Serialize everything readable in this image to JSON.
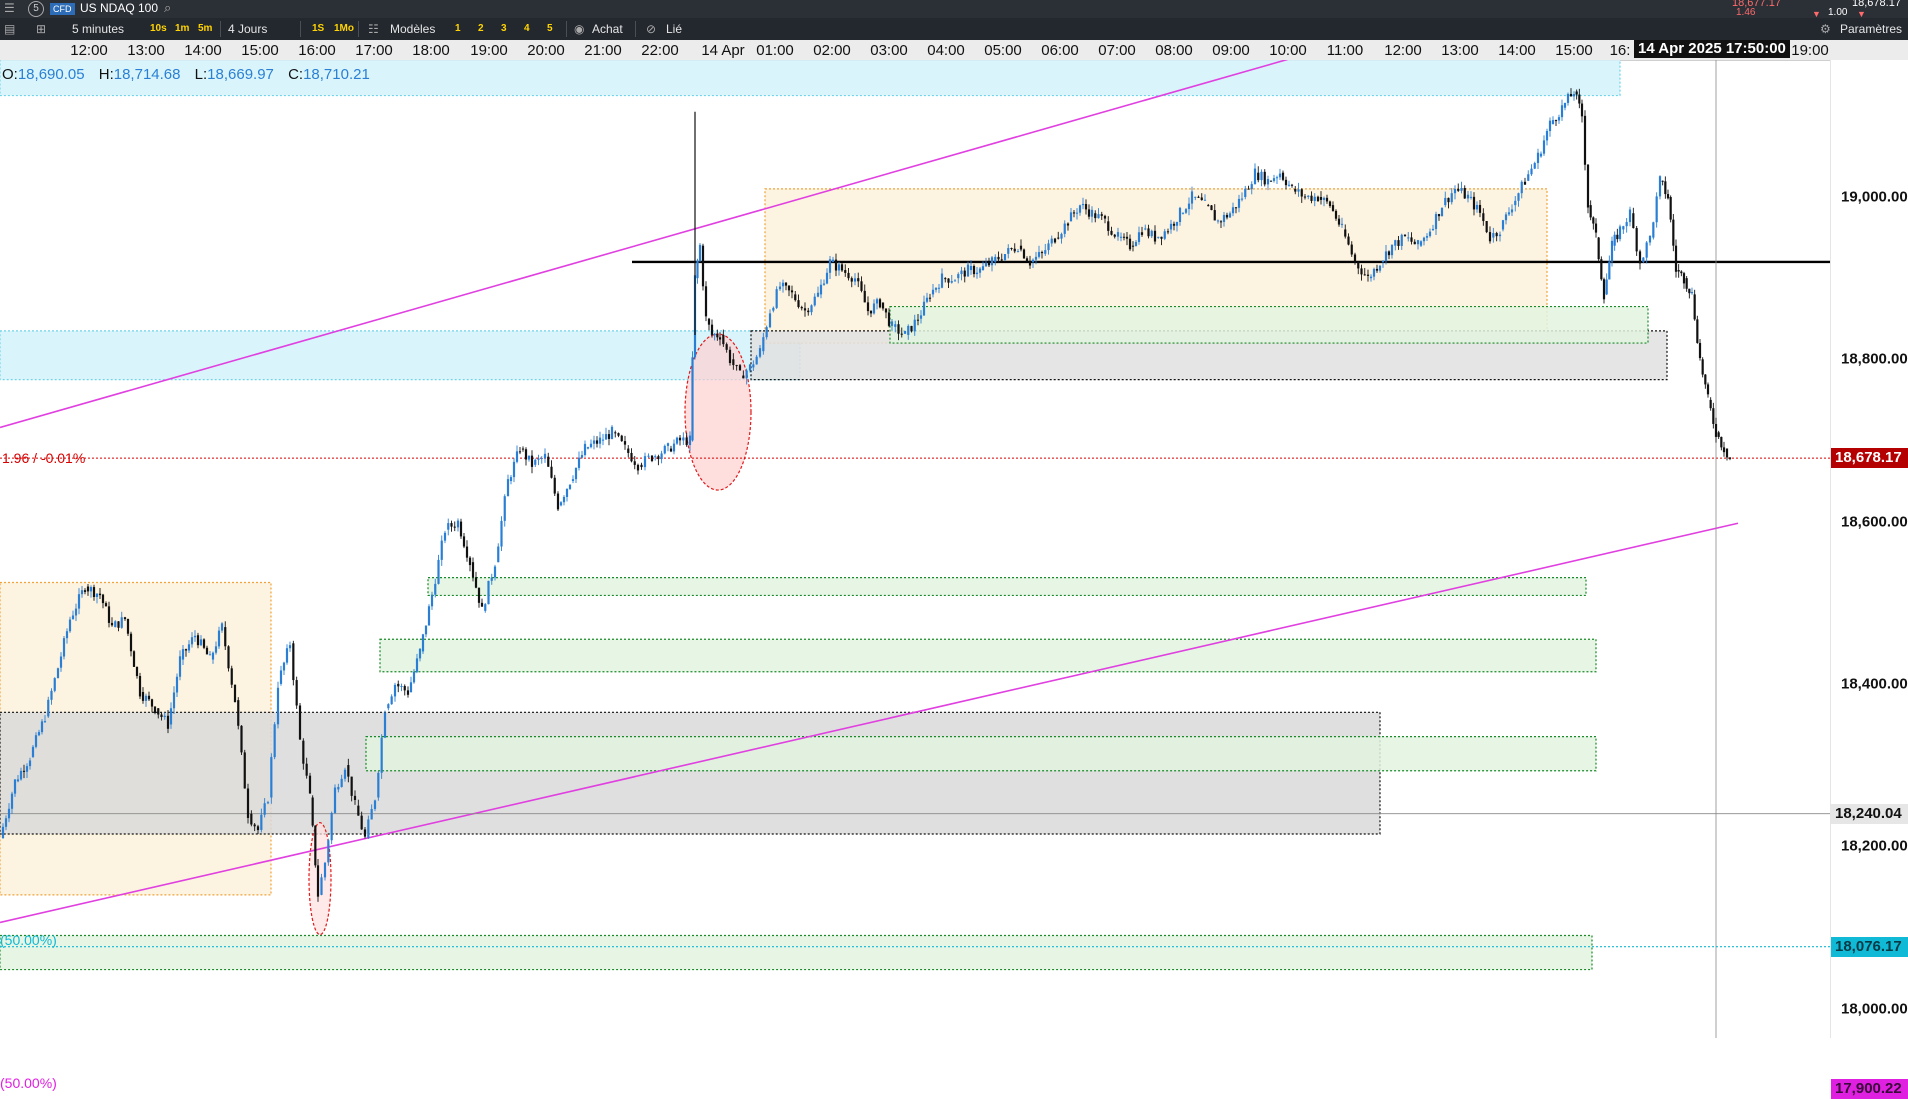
{
  "topbar": {
    "product_type": "CFD",
    "symbol": "US NDAQ 100",
    "price_left": "18,677.17",
    "price_right": "18,678.17",
    "change": "1.46",
    "qty": "1.00"
  },
  "toolbar": {
    "interval": "5 minutes",
    "btn_10s": "10s",
    "btn_1m": "1m",
    "btn_5m": "5m",
    "range": "4 Jours",
    "btn_1s": "1S",
    "btn_1mo": "1Mo",
    "templates": "Modèles",
    "n1": "1",
    "n2": "2",
    "n3": "3",
    "n4": "4",
    "n5": "5",
    "buy": "Achat",
    "linked": "Lié",
    "settings": "Paramètres"
  },
  "ohlc": {
    "o_label": "O:",
    "o": "18,690.05",
    "h_label": "H:",
    "h": "18,714.68",
    "l_label": "L:",
    "l": "18,669.97",
    "c_label": "C:",
    "c": "18,710.21"
  },
  "cursor_time": "14 Apr 2025 17:50:00",
  "chart_data": {
    "type": "candlestick",
    "interval": "5 minutes",
    "x_ticks": [
      "12:00",
      "13:00",
      "14:00",
      "15:00",
      "16:00",
      "17:00",
      "18:00",
      "19:00",
      "20:00",
      "21:00",
      "22:00",
      "14 Apr",
      "01:00",
      "02:00",
      "03:00",
      "04:00",
      "05:00",
      "06:00",
      "07:00",
      "08:00",
      "09:00",
      "10:00",
      "11:00",
      "12:00",
      "13:00",
      "14:00",
      "15:00",
      "16:",
      "17:",
      "19:00"
    ],
    "y_ticks": [
      19000,
      18800,
      18600,
      18400,
      18200,
      18000
    ],
    "y_tick_labels": [
      "19,000.00",
      "18,800.00",
      "18,600.00",
      "18,400.00",
      "18,200.00",
      "18,000.00"
    ],
    "ylim": [
      17840,
      19280
    ],
    "current_price": {
      "value": 18678.17,
      "label": "18,678.17",
      "change_label": "1.96 / -0.01%",
      "color": "#d80000"
    },
    "crosshair_price": {
      "value": 18240.04,
      "label": "18,240.04"
    },
    "levels": [
      {
        "value": 18076.17,
        "label": "18,076.17",
        "text": "(50.00%)",
        "color": "#10b9d6"
      },
      {
        "value": 17900.22,
        "label": "17,900.22",
        "text": "(50.00%)",
        "color": "#e020e0"
      }
    ],
    "horizontal_line": {
      "value": 18920,
      "color": "#000000"
    },
    "trendlines": [
      {
        "from": [
          0,
          18716
        ],
        "to": [
          1516,
          19250
        ],
        "color": "#e040e0"
      },
      {
        "from": [
          0,
          18106
        ],
        "to": [
          1738,
          18598
        ],
        "color": "#e040e0"
      }
    ],
    "zones": [
      {
        "type": "supply",
        "x0": 0,
        "x1": 1620,
        "y_top": 19290,
        "y_bot": 19125,
        "color": "#d2f3fa"
      },
      {
        "type": "supply",
        "x0": 0,
        "x1": 800,
        "y_top": 18835,
        "y_bot": 18775,
        "color": "#d2f3fa"
      },
      {
        "type": "range",
        "x0": 765,
        "x1": 1547,
        "y_top": 19010,
        "y_bot": 18820,
        "color": "#fdf1dc"
      },
      {
        "type": "range",
        "x0": 0,
        "x1": 271,
        "y_top": 18525,
        "y_bot": 18140,
        "color": "#fdf1dc"
      },
      {
        "type": "gray",
        "x0": 751,
        "x1": 1667,
        "y_top": 18835,
        "y_bot": 18775,
        "color": "#e1e1e1"
      },
      {
        "type": "gray",
        "x0": 0,
        "x1": 1380,
        "y_top": 18365,
        "y_bot": 18215,
        "color": "#d9d9d9"
      },
      {
        "type": "demand",
        "x0": 890,
        "x1": 1648,
        "y_top": 18865,
        "y_bot": 18820,
        "color": "#e2f3df"
      },
      {
        "type": "demand",
        "x0": 428,
        "x1": 1586,
        "y_top": 18531,
        "y_bot": 18509,
        "color": "#e2f3df"
      },
      {
        "type": "demand",
        "x0": 380,
        "x1": 1596,
        "y_top": 18455,
        "y_bot": 18415,
        "color": "#e2f3df"
      },
      {
        "type": "demand",
        "x0": 366,
        "x1": 1596,
        "y_top": 18335,
        "y_bot": 18293,
        "color": "#e2f3df"
      },
      {
        "type": "demand",
        "x0": 0,
        "x1": 1592,
        "y_top": 18090,
        "y_bot": 18048,
        "color": "#e2f3df"
      },
      {
        "type": "demand",
        "x0": 0,
        "x1": 1477,
        "y_top": 17930,
        "y_bot": 17840,
        "color": "#e2f3df"
      }
    ],
    "highlights": [
      {
        "cx": 718,
        "cy": 18735,
        "rx": 33,
        "ry": 78,
        "color": "#ffd0d0"
      },
      {
        "cx": 320,
        "cy": 18160,
        "rx": 11,
        "ry": 56,
        "color": "#ffe0e0"
      }
    ],
    "price_path": [
      [
        0,
        18210
      ],
      [
        15,
        18280
      ],
      [
        30,
        18310
      ],
      [
        45,
        18360
      ],
      [
        58,
        18420
      ],
      [
        70,
        18480
      ],
      [
        85,
        18520
      ],
      [
        100,
        18510
      ],
      [
        112,
        18470
      ],
      [
        125,
        18480
      ],
      [
        140,
        18390
      ],
      [
        155,
        18370
      ],
      [
        168,
        18350
      ],
      [
        180,
        18430
      ],
      [
        195,
        18460
      ],
      [
        210,
        18430
      ],
      [
        222,
        18470
      ],
      [
        235,
        18380
      ],
      [
        248,
        18240
      ],
      [
        258,
        18220
      ],
      [
        268,
        18260
      ],
      [
        278,
        18400
      ],
      [
        290,
        18450
      ],
      [
        300,
        18330
      ],
      [
        310,
        18260
      ],
      [
        318,
        18140
      ],
      [
        325,
        18180
      ],
      [
        335,
        18270
      ],
      [
        345,
        18300
      ],
      [
        355,
        18250
      ],
      [
        365,
        18210
      ],
      [
        375,
        18260
      ],
      [
        385,
        18370
      ],
      [
        395,
        18400
      ],
      [
        408,
        18390
      ],
      [
        420,
        18440
      ],
      [
        432,
        18510
      ],
      [
        445,
        18590
      ],
      [
        458,
        18600
      ],
      [
        470,
        18550
      ],
      [
        482,
        18490
      ],
      [
        495,
        18550
      ],
      [
        508,
        18650
      ],
      [
        520,
        18690
      ],
      [
        532,
        18670
      ],
      [
        545,
        18680
      ],
      [
        558,
        18620
      ],
      [
        570,
        18650
      ],
      [
        585,
        18690
      ],
      [
        600,
        18700
      ],
      [
        612,
        18710
      ],
      [
        625,
        18690
      ],
      [
        638,
        18670
      ],
      [
        652,
        18680
      ],
      [
        668,
        18690
      ],
      [
        680,
        18700
      ],
      [
        690,
        18700
      ],
      [
        695,
        18900
      ],
      [
        700,
        18940
      ],
      [
        706,
        18850
      ],
      [
        712,
        18830
      ],
      [
        720,
        18830
      ],
      [
        730,
        18800
      ],
      [
        740,
        18780
      ],
      [
        750,
        18790
      ],
      [
        760,
        18810
      ],
      [
        770,
        18860
      ],
      [
        780,
        18890
      ],
      [
        792,
        18880
      ],
      [
        805,
        18860
      ],
      [
        818,
        18880
      ],
      [
        830,
        18920
      ],
      [
        842,
        18910
      ],
      [
        855,
        18900
      ],
      [
        868,
        18860
      ],
      [
        880,
        18870
      ],
      [
        892,
        18840
      ],
      [
        905,
        18830
      ],
      [
        918,
        18850
      ],
      [
        930,
        18880
      ],
      [
        942,
        18900
      ],
      [
        955,
        18900
      ],
      [
        968,
        18910
      ],
      [
        980,
        18910
      ],
      [
        992,
        18920
      ],
      [
        1005,
        18930
      ],
      [
        1018,
        18940
      ],
      [
        1030,
        18920
      ],
      [
        1042,
        18930
      ],
      [
        1055,
        18950
      ],
      [
        1068,
        18970
      ],
      [
        1080,
        18990
      ],
      [
        1092,
        18980
      ],
      [
        1105,
        18970
      ],
      [
        1118,
        18950
      ],
      [
        1130,
        18940
      ],
      [
        1142,
        18960
      ],
      [
        1155,
        18950
      ],
      [
        1168,
        18960
      ],
      [
        1180,
        18980
      ],
      [
        1192,
        19000
      ],
      [
        1205,
        18990
      ],
      [
        1218,
        18970
      ],
      [
        1230,
        18980
      ],
      [
        1242,
        19000
      ],
      [
        1255,
        19030
      ],
      [
        1268,
        19020
      ],
      [
        1280,
        19030
      ],
      [
        1292,
        19010
      ],
      [
        1305,
        19000
      ],
      [
        1318,
        19000
      ],
      [
        1330,
        18990
      ],
      [
        1342,
        18960
      ],
      [
        1355,
        18920
      ],
      [
        1368,
        18900
      ],
      [
        1380,
        18920
      ],
      [
        1392,
        18940
      ],
      [
        1405,
        18950
      ],
      [
        1418,
        18940
      ],
      [
        1430,
        18960
      ],
      [
        1442,
        18990
      ],
      [
        1455,
        19010
      ],
      [
        1468,
        19000
      ],
      [
        1480,
        18980
      ],
      [
        1490,
        18950
      ],
      [
        1500,
        18960
      ],
      [
        1512,
        18990
      ],
      [
        1525,
        19020
      ],
      [
        1538,
        19050
      ],
      [
        1550,
        19090
      ],
      [
        1562,
        19110
      ],
      [
        1574,
        19130
      ],
      [
        1582,
        19100
      ],
      [
        1588,
        18990
      ],
      [
        1596,
        18950
      ],
      [
        1604,
        18880
      ],
      [
        1612,
        18940
      ],
      [
        1620,
        18960
      ],
      [
        1630,
        18980
      ],
      [
        1640,
        18920
      ],
      [
        1650,
        18950
      ],
      [
        1660,
        19020
      ],
      [
        1668,
        19000
      ],
      [
        1676,
        18910
      ],
      [
        1684,
        18900
      ],
      [
        1692,
        18880
      ],
      [
        1700,
        18800
      ],
      [
        1708,
        18750
      ],
      [
        1716,
        18710
      ],
      [
        1724,
        18690
      ],
      [
        1730,
        18678
      ]
    ],
    "price_path_note": ""
  }
}
